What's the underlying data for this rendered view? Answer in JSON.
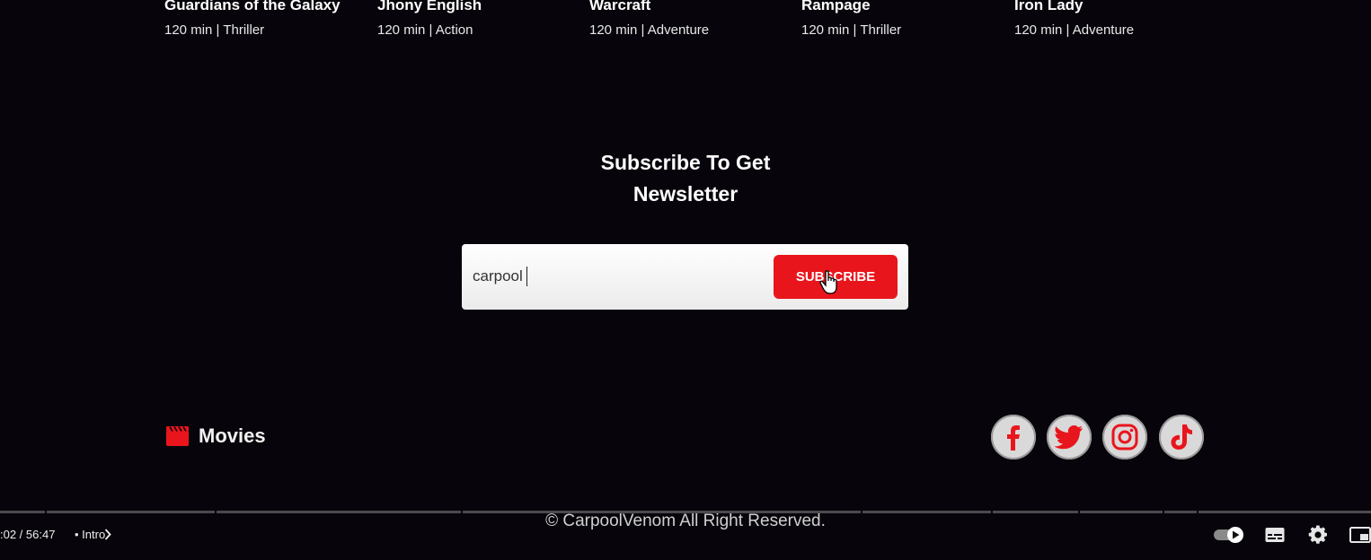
{
  "movies": [
    {
      "title": "Guardians of the Galaxy",
      "meta": "120 min | Thriller"
    },
    {
      "title": "Jhony English",
      "meta": "120 min | Action"
    },
    {
      "title": "Warcraft",
      "meta": "120 min | Adventure"
    },
    {
      "title": "Rampage",
      "meta": "120 min | Thriller"
    },
    {
      "title": "Iron Lady",
      "meta": "120 min | Adventure"
    }
  ],
  "newsletter": {
    "title_line1": "Subscribe To Get",
    "title_line2": "Newsletter",
    "input_value": "carpool",
    "button_label": "SUBSCRIBE"
  },
  "footer": {
    "brand_label": "Movies",
    "brand_icon": "clapperboard-icon",
    "social": [
      "facebook-icon",
      "twitter-icon",
      "instagram-icon",
      "tiktok-icon"
    ],
    "copyright": "© CarpoolVenom All Right Reserved."
  },
  "player": {
    "time": ":02 / 56:47",
    "chapter": "• Intro"
  },
  "colors": {
    "background": "#07050b",
    "accent": "#e9151c",
    "social_bg": "#d9d9d9"
  }
}
